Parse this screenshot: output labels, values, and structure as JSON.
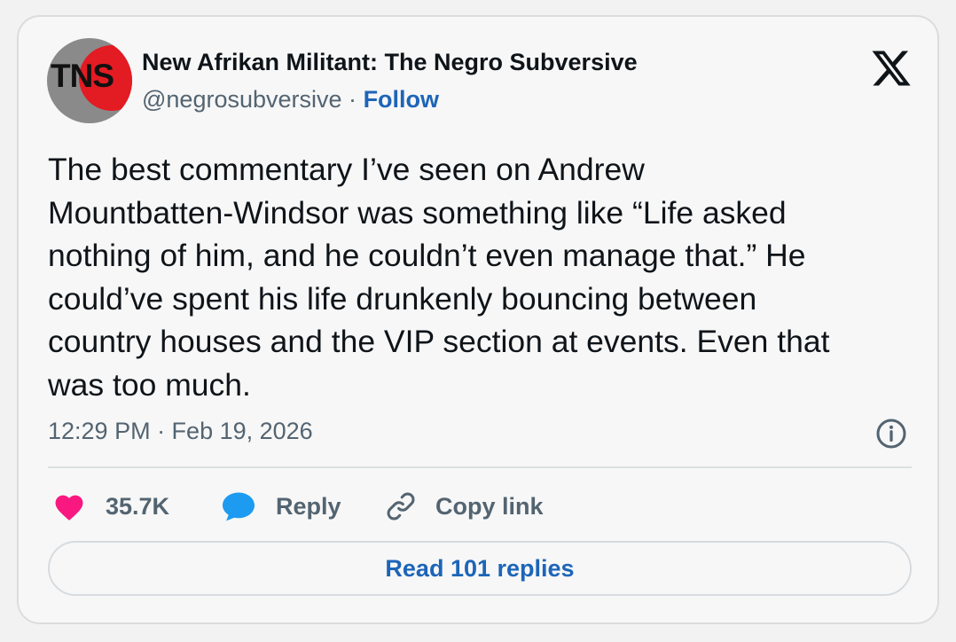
{
  "avatar": {
    "text": "TNS",
    "alt": "New Afrikan Militant: The Negro Subversive"
  },
  "author": {
    "name": "New Afrikan Militant: The Negro Subversive",
    "handle": "@negrosubversive",
    "separator": "·",
    "follow_label": "Follow"
  },
  "tweet": {
    "text": "The best commentary I’ve seen on Andrew\nMountbatten-Windsor was something like “Life asked\nnothing of him, and he couldn’t even manage that.” He\ncould’ve spent his life drunkenly bouncing between\ncountry houses and the VIP section at events. Even that\nwas too much.",
    "timestamp": "12:29 PM · Feb 19, 2026"
  },
  "actions": {
    "like_count": "35.7K",
    "reply_label": "Reply",
    "copy_link_label": "Copy link",
    "read_replies_label": "Read 101 replies"
  },
  "icons": {
    "brand": "x-logo-icon",
    "info": "info-icon",
    "like": "heart-icon",
    "reply": "speech-bubble-icon",
    "copy": "link-icon"
  },
  "colors": {
    "accent_blue": "#1d65b8",
    "heart_pink": "#f91880",
    "reply_blue": "#1d9bf0",
    "secondary_text": "#536471"
  }
}
